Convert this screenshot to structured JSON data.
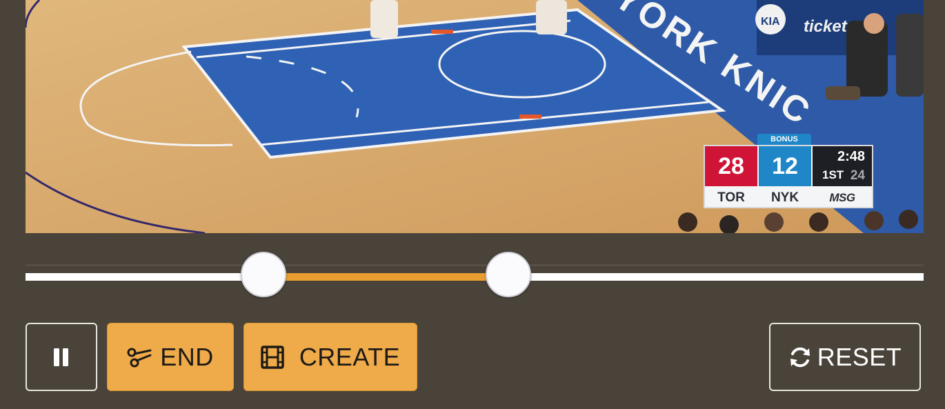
{
  "video": {
    "scoreboard": {
      "bonus": "BONUS",
      "away": {
        "score": "28",
        "abbr": "TOR",
        "color": "#cf1438"
      },
      "home": {
        "score": "12",
        "abbr": "NYK",
        "color": "#1f86c8"
      },
      "clock": "2:48",
      "period": "1ST",
      "shot_clock": "24",
      "network": "MSG"
    },
    "court_text": "YORK KNIC",
    "sponsors": [
      "KIA",
      "ticket"
    ]
  },
  "timeline": {
    "range_start": 0.265,
    "range_end": 0.538,
    "colors": {
      "track": "#ffffff",
      "range": "#e89e2e",
      "background": "#4a433a"
    }
  },
  "controls": {
    "pause": {
      "icon": "pause-icon"
    },
    "end": {
      "label": "END",
      "icon": "scissors-icon"
    },
    "create": {
      "label": "CREATE",
      "icon": "film-icon"
    },
    "reset": {
      "label": "RESET",
      "icon": "refresh-icon"
    }
  }
}
